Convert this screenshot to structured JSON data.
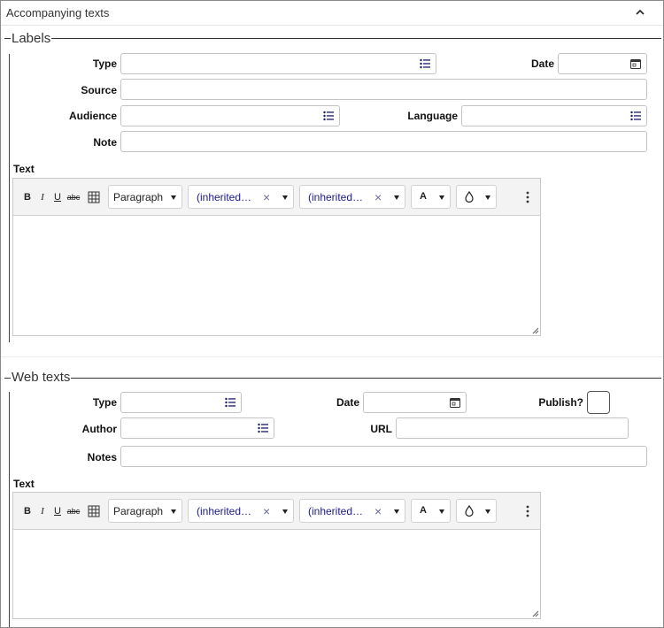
{
  "panel": {
    "title": "Accompanying texts"
  },
  "labels": {
    "legend": "Labels",
    "type_label": "Type",
    "date_label": "Date",
    "source_label": "Source",
    "audience_label": "Audience",
    "language_label": "Language",
    "note_label": "Note",
    "text_label": "Text",
    "type_value": "",
    "date_value": "",
    "source_value": "",
    "audience_value": "",
    "language_value": "",
    "note_value": ""
  },
  "web": {
    "legend": "Web texts",
    "type_label": "Type",
    "date_label": "Date",
    "publish_label": "Publish?",
    "author_label": "Author",
    "url_label": "URL",
    "notes_label": "Notes",
    "text_label": "Text",
    "type_value": "",
    "date_value": "",
    "author_value": "",
    "url_value": "",
    "notes_value": ""
  },
  "toolbar": {
    "bold": "B",
    "italic": "I",
    "underline": "U",
    "strike": "abc",
    "paragraph": "Paragraph",
    "font_family": "(inherited…",
    "font_size": "(inherited…",
    "clear": "×",
    "font_color": "A"
  },
  "icons": {
    "list": "list-icon",
    "calendar": "calendar-icon",
    "chevron": "chevron-up-icon",
    "table": "table-icon",
    "highlight": "drop-icon",
    "more": "more-vertical-icon"
  }
}
